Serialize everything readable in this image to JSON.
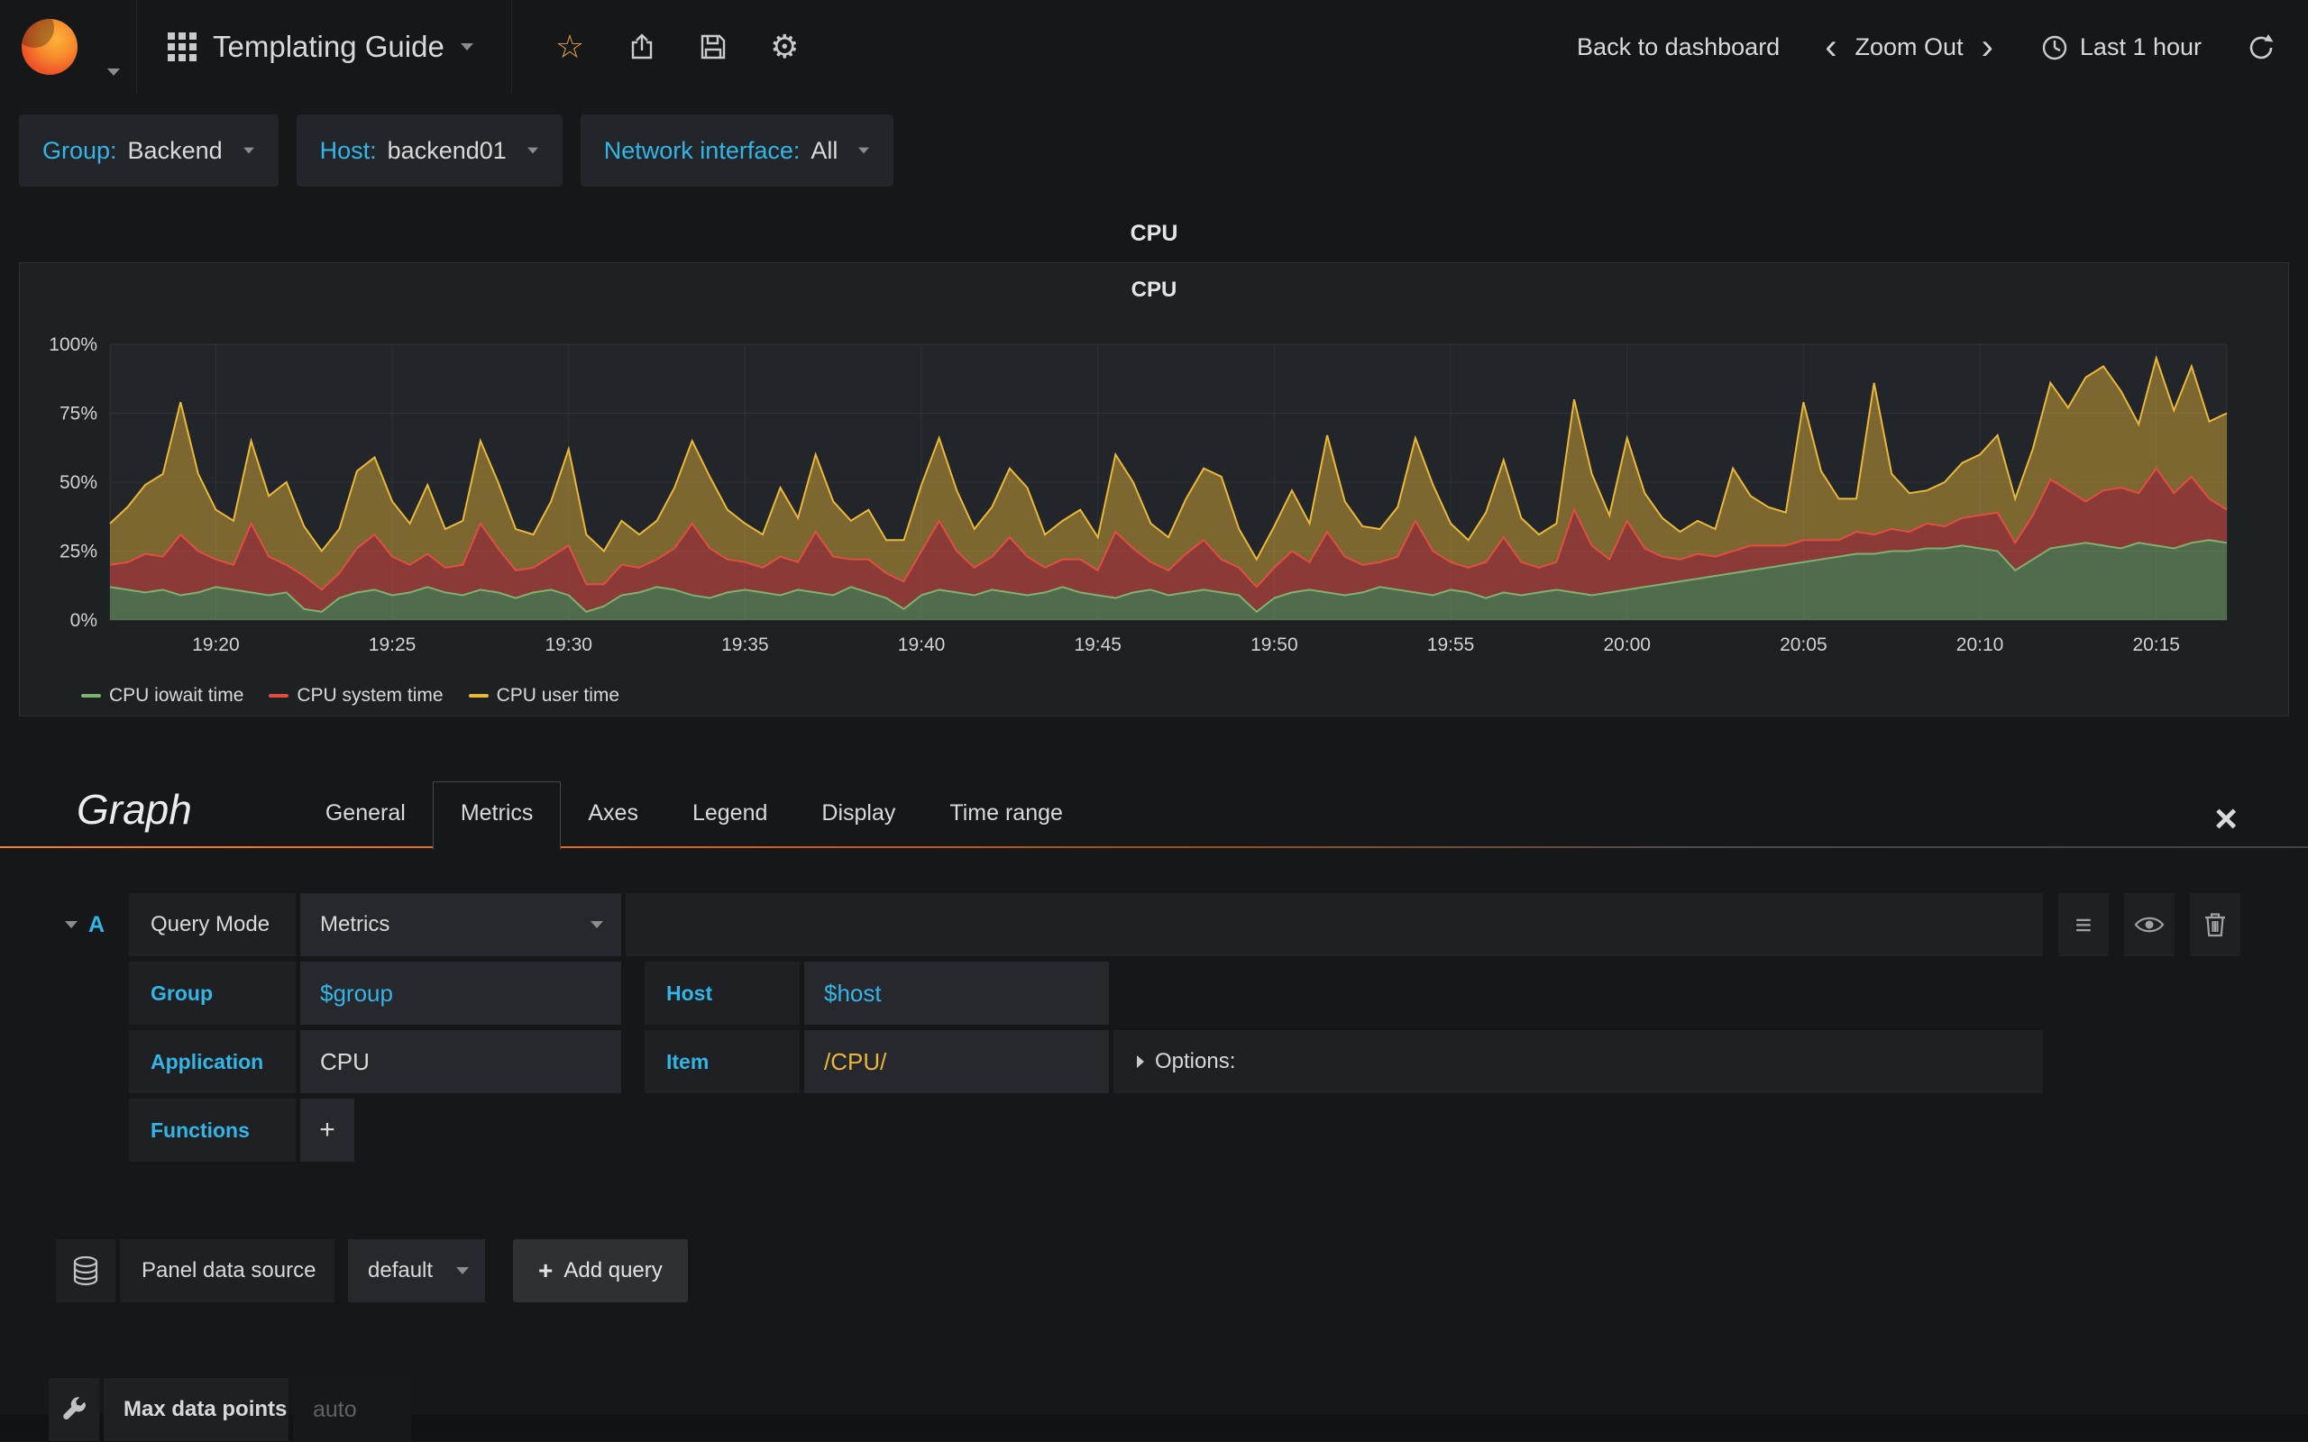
{
  "colors": {
    "accent": "#33B5E5",
    "yellow": "#EAB839",
    "brand_orange": "#eb6c24"
  },
  "icons": {
    "star": "☆",
    "gear": "⚙",
    "menu": "≡",
    "chevron_left": "‹",
    "chevron_right": "›",
    "close": "×",
    "plus": "+"
  },
  "navbar": {
    "title": "Templating Guide",
    "back_to_dashboard": "Back to dashboard",
    "zoom_out": "Zoom Out",
    "time_range": "Last 1 hour"
  },
  "variables": [
    {
      "label": "Group:",
      "value": "Backend"
    },
    {
      "label": "Host:",
      "value": "backend01"
    },
    {
      "label": "Network interface:",
      "value": "All"
    }
  ],
  "panel": {
    "fullscreen_title": "CPU",
    "title": "CPU"
  },
  "chart_data": {
    "type": "area",
    "stacked": true,
    "title": "CPU",
    "unit": "percent",
    "ylim": [
      0,
      100
    ],
    "yticks": [
      0,
      25,
      50,
      75,
      100
    ],
    "x_start": "19:17",
    "x_end": "20:17",
    "step_seconds": 30,
    "grid": true,
    "legend_position": "bottom-left",
    "xticks": [
      {
        "label": "19:20",
        "i": 6
      },
      {
        "label": "19:25",
        "i": 16
      },
      {
        "label": "19:30",
        "i": 26
      },
      {
        "label": "19:35",
        "i": 36
      },
      {
        "label": "19:40",
        "i": 46
      },
      {
        "label": "19:45",
        "i": 56
      },
      {
        "label": "19:50",
        "i": 66
      },
      {
        "label": "19:55",
        "i": 76
      },
      {
        "label": "20:00",
        "i": 86
      },
      {
        "label": "20:05",
        "i": 96
      },
      {
        "label": "20:10",
        "i": 106
      },
      {
        "label": "20:15",
        "i": 116
      }
    ],
    "series": [
      {
        "name": "CPU iowait time",
        "color": "#7EB26D",
        "values": [
          12,
          11,
          10,
          11,
          9,
          10,
          12,
          11,
          10,
          9,
          10,
          4,
          3,
          8,
          10,
          11,
          9,
          10,
          12,
          10,
          9,
          11,
          10,
          8,
          10,
          11,
          9,
          3,
          5,
          9,
          10,
          12,
          11,
          9,
          8,
          10,
          11,
          10,
          9,
          11,
          10,
          9,
          12,
          10,
          8,
          4,
          9,
          11,
          10,
          9,
          11,
          10,
          9,
          10,
          12,
          10,
          9,
          8,
          10,
          11,
          9,
          10,
          11,
          10,
          9,
          3,
          8,
          10,
          11,
          10,
          9,
          10,
          12,
          11,
          10,
          9,
          11,
          10,
          8,
          10,
          9,
          10,
          11,
          10,
          9,
          10,
          11,
          12,
          13,
          14,
          15,
          16,
          17,
          18,
          19,
          20,
          21,
          22,
          23,
          24,
          24,
          25,
          25,
          26,
          26,
          27,
          26,
          25,
          18,
          22,
          26,
          27,
          28,
          27,
          26,
          28,
          27,
          26,
          28,
          29,
          28
        ]
      },
      {
        "name": "CPU system time",
        "color": "#E24D42",
        "values": [
          8,
          10,
          14,
          12,
          22,
          15,
          10,
          9,
          25,
          14,
          10,
          12,
          8,
          9,
          16,
          20,
          14,
          10,
          12,
          9,
          11,
          24,
          16,
          10,
          9,
          12,
          18,
          10,
          8,
          11,
          9,
          10,
          15,
          26,
          18,
          12,
          10,
          9,
          14,
          10,
          22,
          14,
          10,
          12,
          9,
          10,
          16,
          25,
          15,
          10,
          12,
          20,
          14,
          9,
          10,
          12,
          9,
          24,
          16,
          10,
          9,
          14,
          18,
          12,
          10,
          9,
          11,
          15,
          10,
          22,
          14,
          10,
          9,
          12,
          26,
          16,
          10,
          9,
          13,
          20,
          12,
          9,
          10,
          30,
          18,
          12,
          25,
          14,
          10,
          8,
          9,
          7,
          8,
          9,
          8,
          7,
          8,
          7,
          6,
          8,
          7,
          8,
          7,
          9,
          8,
          10,
          12,
          14,
          10,
          16,
          25,
          20,
          15,
          20,
          22,
          18,
          28,
          20,
          24,
          15,
          12
        ]
      },
      {
        "name": "CPU user time",
        "color": "#EAB839",
        "values": [
          15,
          20,
          25,
          30,
          48,
          28,
          18,
          16,
          30,
          22,
          30,
          18,
          14,
          16,
          28,
          28,
          20,
          15,
          25,
          14,
          16,
          30,
          24,
          15,
          12,
          20,
          35,
          18,
          12,
          16,
          12,
          14,
          22,
          30,
          26,
          18,
          14,
          12,
          25,
          16,
          28,
          20,
          14,
          18,
          12,
          15,
          24,
          30,
          22,
          14,
          18,
          25,
          25,
          12,
          14,
          18,
          12,
          28,
          24,
          14,
          12,
          20,
          26,
          30,
          14,
          10,
          15,
          22,
          14,
          35,
          20,
          14,
          12,
          18,
          30,
          24,
          14,
          10,
          18,
          28,
          16,
          12,
          14,
          40,
          26,
          16,
          30,
          20,
          14,
          10,
          12,
          10,
          30,
          18,
          14,
          12,
          50,
          25,
          15,
          12,
          55,
          20,
          14,
          12,
          16,
          20,
          22,
          28,
          16,
          24,
          35,
          30,
          45,
          45,
          35,
          25,
          40,
          30,
          40,
          28,
          35
        ]
      }
    ]
  },
  "editor": {
    "panel_type": "Graph",
    "tabs": [
      "General",
      "Metrics",
      "Axes",
      "Legend",
      "Display",
      "Time range"
    ],
    "active_tab": "Metrics",
    "query": {
      "letter": "A",
      "mode_label": "Query Mode",
      "mode_value": "Metrics",
      "group_label": "Group",
      "group_value": "$group",
      "host_label": "Host",
      "host_value": "$host",
      "application_label": "Application",
      "application_value": "CPU",
      "item_label": "Item",
      "item_value": "/CPU/",
      "options_label": "Options:",
      "functions_label": "Functions"
    },
    "datasource": {
      "label": "Panel data source",
      "value": "default",
      "add_query_label": "Add query"
    },
    "max_data_points": {
      "label": "Max data points",
      "placeholder": "auto"
    }
  }
}
